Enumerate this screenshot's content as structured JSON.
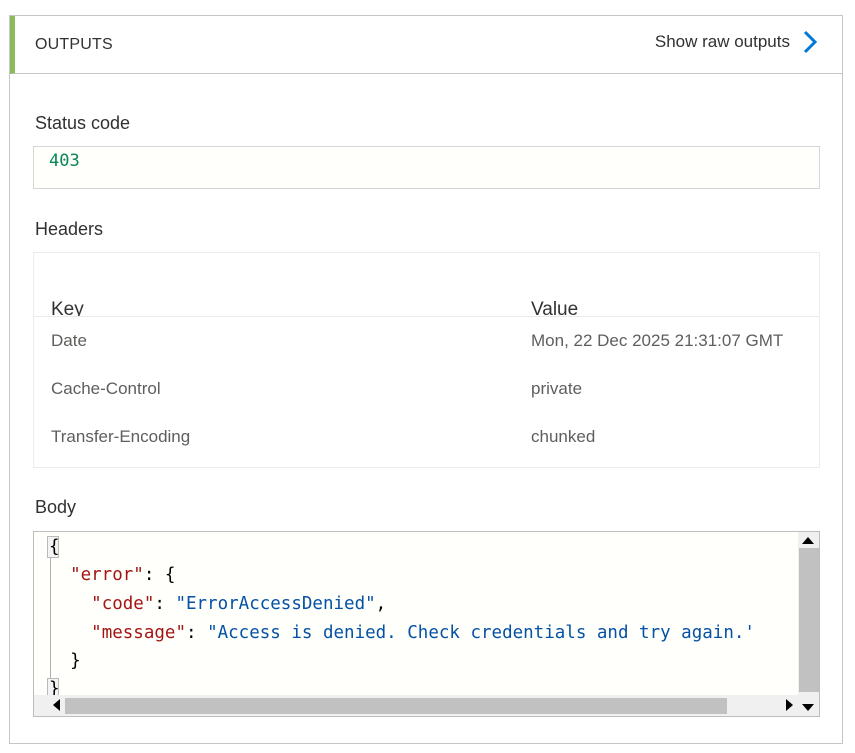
{
  "header": {
    "title": "OUTPUTS",
    "raw_link_label": "Show raw outputs",
    "raw_link_icon": "chevron-right-icon",
    "accent_color": "#8cbb5c",
    "link_icon_color": "#0078d4"
  },
  "status": {
    "label": "Status code",
    "value": "403"
  },
  "headers": {
    "label": "Headers",
    "columns": [
      "Key",
      "Value"
    ],
    "rows": [
      {
        "key": "Date",
        "value": "Mon, 22 Dec 2025 21:31:07 GMT"
      },
      {
        "key": "Cache-Control",
        "value": "private"
      },
      {
        "key": "Transfer-Encoding",
        "value": "chunked"
      }
    ]
  },
  "body": {
    "label": "Body",
    "code": {
      "open_brace": "{",
      "error_key": "\"error\"",
      "error_open": ": {",
      "code_key": "\"code\"",
      "code_value": "\"ErrorAccessDenied\"",
      "message_key": "\"message\"",
      "message_value": "\"Access is denied. Check credentials and try again.'",
      "inner_close": "}",
      "close_brace": "}"
    },
    "colors": {
      "key": "#a31515",
      "string": "#0451a5",
      "number": "#098658"
    }
  }
}
